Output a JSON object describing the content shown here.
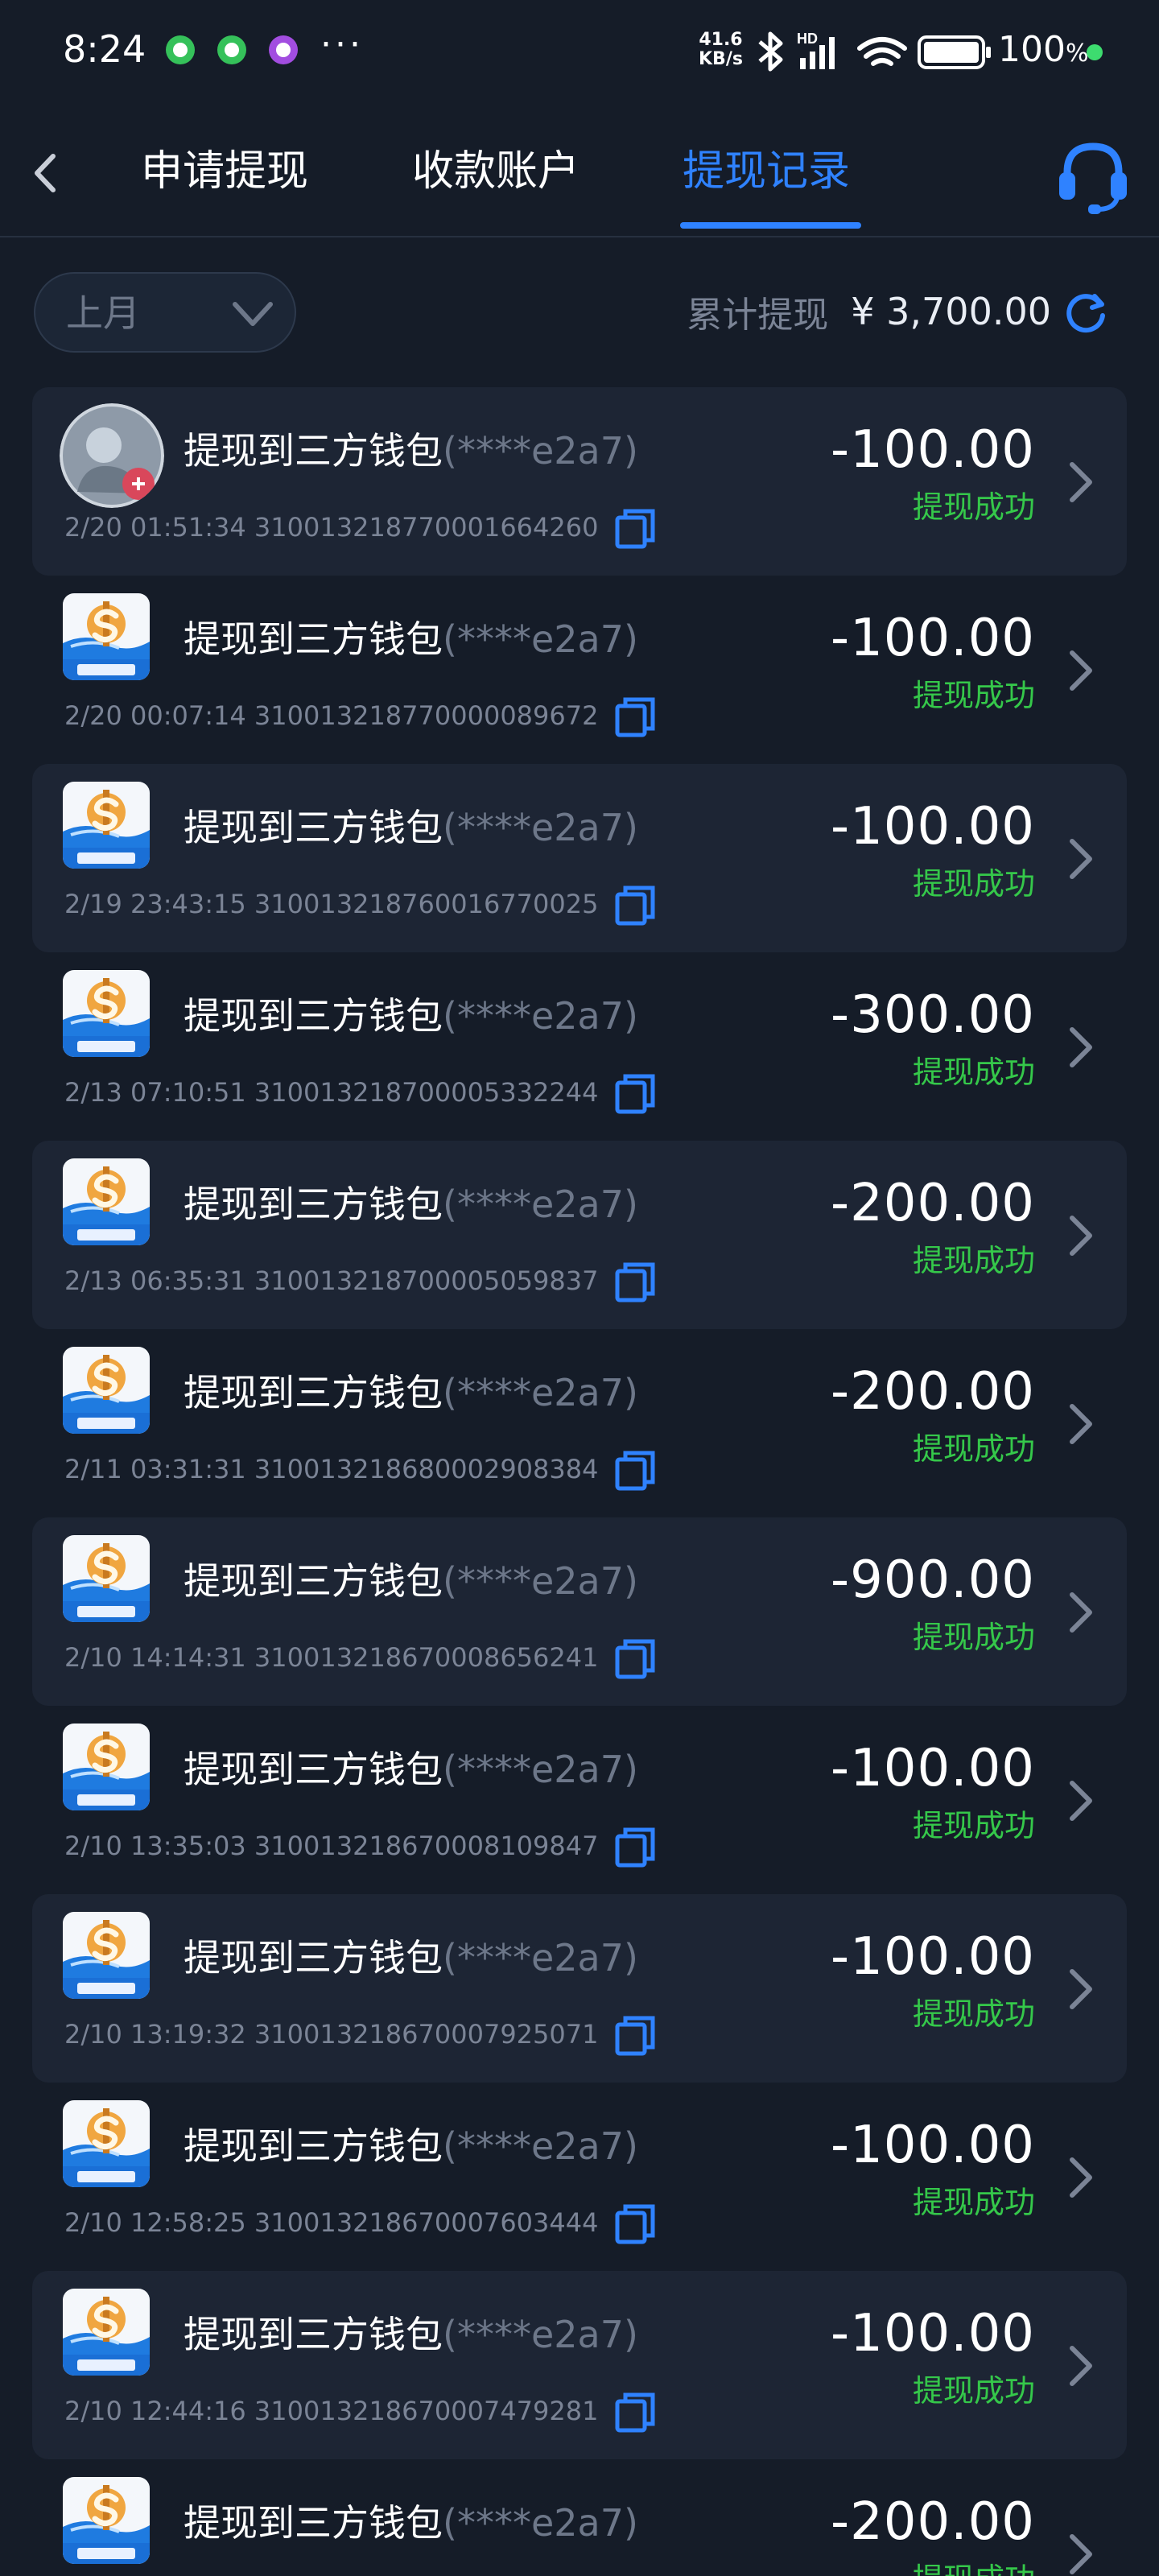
{
  "status_bar": {
    "time": "8:24",
    "net_speed_value": "41.6",
    "net_speed_unit": "KB/s",
    "hd_label": "HD",
    "battery": "100",
    "battery_sign": "%",
    "dots": "···",
    "icons": [
      "chat-app-icon",
      "shop-app-icon",
      "game-app-icon",
      "bluetooth-icon",
      "signal-icon",
      "wifi-icon",
      "battery-icon"
    ]
  },
  "nav": {
    "tabs": [
      {
        "label": "申请提现",
        "active": false
      },
      {
        "label": "收款账户",
        "active": false
      },
      {
        "label": "提现记录",
        "active": true
      }
    ],
    "accent_color": "#2f82ff"
  },
  "filter": {
    "month": "上月",
    "total_label": "累计提现",
    "total_value": "¥ 3,700.00"
  },
  "records": [
    {
      "title": "提现到三方钱包",
      "account": "(****e2a7)",
      "meta": "2/20 01:51:34 310013218770001664260",
      "amount": "-100.00",
      "status": "提现成功",
      "avatar": "user-avatar"
    },
    {
      "title": "提现到三方钱包",
      "account": "(****e2a7)",
      "meta": "2/20 00:07:14 310013218770000089672",
      "amount": "-100.00",
      "status": "提现成功",
      "avatar": "wallet-logo"
    },
    {
      "title": "提现到三方钱包",
      "account": "(****e2a7)",
      "meta": "2/19 23:43:15 310013218760016770025",
      "amount": "-100.00",
      "status": "提现成功",
      "avatar": "wallet-logo"
    },
    {
      "title": "提现到三方钱包",
      "account": "(****e2a7)",
      "meta": "2/13 07:10:51 310013218700005332244",
      "amount": "-300.00",
      "status": "提现成功",
      "avatar": "wallet-logo"
    },
    {
      "title": "提现到三方钱包",
      "account": "(****e2a7)",
      "meta": "2/13 06:35:31 310013218700005059837",
      "amount": "-200.00",
      "status": "提现成功",
      "avatar": "wallet-logo"
    },
    {
      "title": "提现到三方钱包",
      "account": "(****e2a7)",
      "meta": "2/11 03:31:31 310013218680002908384",
      "amount": "-200.00",
      "status": "提现成功",
      "avatar": "wallet-logo"
    },
    {
      "title": "提现到三方钱包",
      "account": "(****e2a7)",
      "meta": "2/10 14:14:31 310013218670008656241",
      "amount": "-900.00",
      "status": "提现成功",
      "avatar": "wallet-logo"
    },
    {
      "title": "提现到三方钱包",
      "account": "(****e2a7)",
      "meta": "2/10 13:35:03 310013218670008109847",
      "amount": "-100.00",
      "status": "提现成功",
      "avatar": "wallet-logo"
    },
    {
      "title": "提现到三方钱包",
      "account": "(****e2a7)",
      "meta": "2/10 13:19:32 310013218670007925071",
      "amount": "-100.00",
      "status": "提现成功",
      "avatar": "wallet-logo"
    },
    {
      "title": "提现到三方钱包",
      "account": "(****e2a7)",
      "meta": "2/10 12:58:25 310013218670007603444",
      "amount": "-100.00",
      "status": "提现成功",
      "avatar": "wallet-logo"
    },
    {
      "title": "提现到三方钱包",
      "account": "(****e2a7)",
      "meta": "2/10 12:44:16 310013218670007479281",
      "amount": "-100.00",
      "status": "提现成功",
      "avatar": "wallet-logo"
    },
    {
      "title": "提现到三方钱包",
      "account": "(****e2a7)",
      "meta": "",
      "amount": "-200.00",
      "status": "提现成功",
      "avatar": "wallet-logo"
    }
  ],
  "colors": {
    "background": "#151c28",
    "card_alt": "#1d2534",
    "success": "#35c84a",
    "muted_text": "#7b8496"
  }
}
